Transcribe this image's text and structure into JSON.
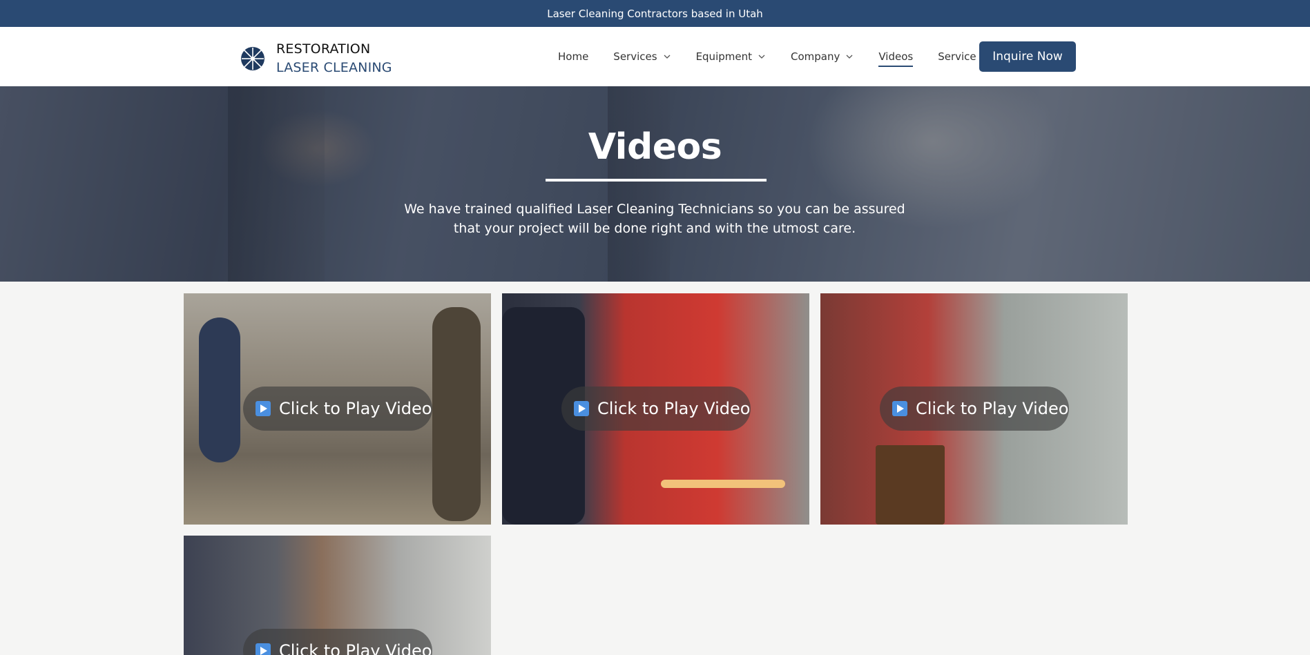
{
  "topbar": {
    "text": "Laser Cleaning Contractors based in Utah"
  },
  "logo": {
    "line1": "RESTORATION",
    "line2": "LASER CLEANING"
  },
  "nav": {
    "items": [
      {
        "label": "Home",
        "has_dropdown": false,
        "active": false
      },
      {
        "label": "Services",
        "has_dropdown": true,
        "active": false
      },
      {
        "label": "Equipment",
        "has_dropdown": true,
        "active": false
      },
      {
        "label": "Company",
        "has_dropdown": true,
        "active": false
      },
      {
        "label": "Videos",
        "has_dropdown": false,
        "active": true
      },
      {
        "label": "Service Area",
        "has_dropdown": false,
        "active": false
      }
    ],
    "cta": "Inquire Now"
  },
  "hero": {
    "title": "Videos",
    "text": "We have trained qualified Laser Cleaning Technicians so you can be assured that your project will be done right and with the utmost care."
  },
  "videos": [
    {
      "label": "Click to Play Video"
    },
    {
      "label": "Click to Play Video"
    },
    {
      "label": "Click to Play Video"
    },
    {
      "label": "Click to Play Video"
    }
  ],
  "colors": {
    "brand": "#2a4a73",
    "background": "#f5f5f4"
  }
}
